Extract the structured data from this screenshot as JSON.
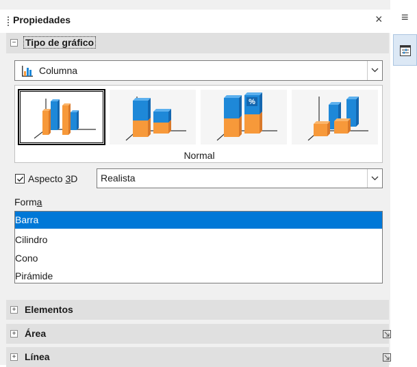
{
  "panel": {
    "title": "Propiedades",
    "close_glyph": "×",
    "menu_glyph": "≡"
  },
  "sections": {
    "chart_type": {
      "title": "Tipo de gráfico",
      "expander": "⊟"
    },
    "elements": {
      "title": "Elementos",
      "expander": "⊞"
    },
    "area": {
      "title": "Área",
      "expander": "⊞"
    },
    "line": {
      "title": "Línea",
      "expander": "⊞"
    }
  },
  "chart_type_dropdown": {
    "value": "Columna",
    "icon": "column-chart-icon"
  },
  "gallery": {
    "selected_label": "Normal",
    "thumbs": [
      "normal",
      "stacked",
      "percent-stacked",
      "deep"
    ],
    "percent_glyph": "%"
  },
  "aspect_3d": {
    "label_pre": "Aspecto ",
    "label_key": "3",
    "label_post": "D",
    "checked": true,
    "value": "Realista"
  },
  "shape": {
    "label_pre": "Form",
    "label_key": "a",
    "items": [
      "Barra",
      "Cilindro",
      "Cono",
      "Pirámide"
    ],
    "selected": "Barra"
  },
  "colors": {
    "bar_blue": "#1e88d8",
    "bar_orange": "#f7993a",
    "selection": "#0078d7"
  }
}
